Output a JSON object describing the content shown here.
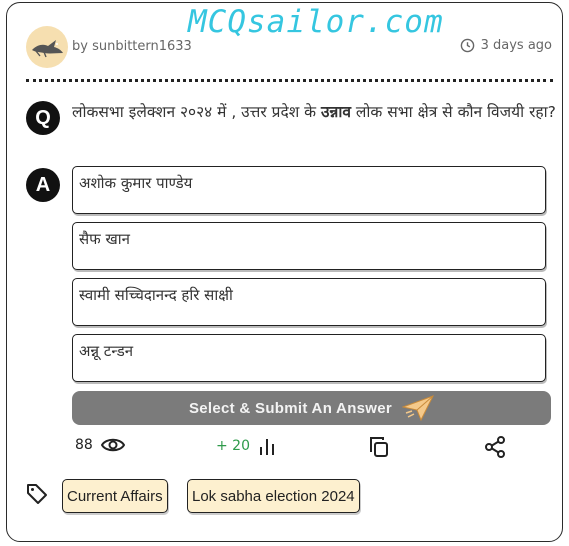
{
  "watermark": "MCQsailor.com",
  "post": {
    "author": "by sunbittern1633",
    "time_ago": "3 days ago",
    "avatar_icon": "bird-icon"
  },
  "question": {
    "badge": "Q",
    "text_before": "लोकसभा इलेक्शन २०२४ में , उत्तर प्रदेश के ",
    "text_bold": "उन्नाव",
    "text_after": " लोक सभा क्षेत्र से कौन विजयी रहा?"
  },
  "answers": {
    "badge": "A",
    "options": [
      "अशोक कुमार पाण्डेय",
      "सैफ खान",
      "स्वामी सच्चिदानन्द हरि साक्षी",
      "अन्नू टन्डन"
    ]
  },
  "submit": {
    "label": "Select & Submit An Answer",
    "icon": "paper-plane-icon"
  },
  "stats": {
    "views": "88",
    "votes": "+ 20"
  },
  "tags": [
    "Current Affairs",
    "Lok sabha election 2024"
  ],
  "colors": {
    "watermark": "#35c6e0",
    "avatar_bg": "#f6dfb0",
    "submit_bg": "#7b7b7b",
    "votes": "#2e9a4a",
    "tag_bg": "#fdf0cf"
  }
}
